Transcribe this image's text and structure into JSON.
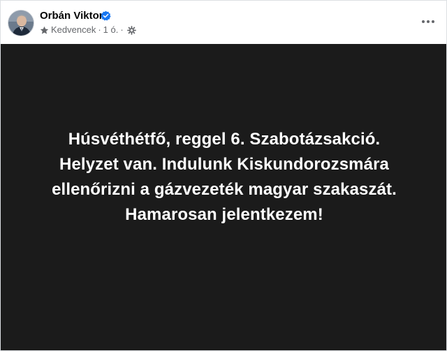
{
  "author": {
    "name": "Orbán Viktor",
    "verified": true
  },
  "meta": {
    "favorites_label": "Kedvencek",
    "separator": "·",
    "time": "1 ó.",
    "audience_icon": "globe-gear-icon"
  },
  "post": {
    "background_color": "#1b1b1b",
    "text_color": "#ffffff",
    "lines": [
      "Húsvéthétfő, reggel 6. Szabotázsakció.",
      "Helyzet van. Indulunk Kiskundorozsmára",
      "ellenőrizni a gázvezeték magyar szakaszát.",
      "Hamarosan jelentkezem!"
    ]
  },
  "icons": {
    "verified": "verified-badge-icon",
    "star": "star-icon",
    "more": "more-options-icon"
  },
  "colors": {
    "verified": "#1877f2",
    "meta_text": "#65676b",
    "name_text": "#050505"
  }
}
